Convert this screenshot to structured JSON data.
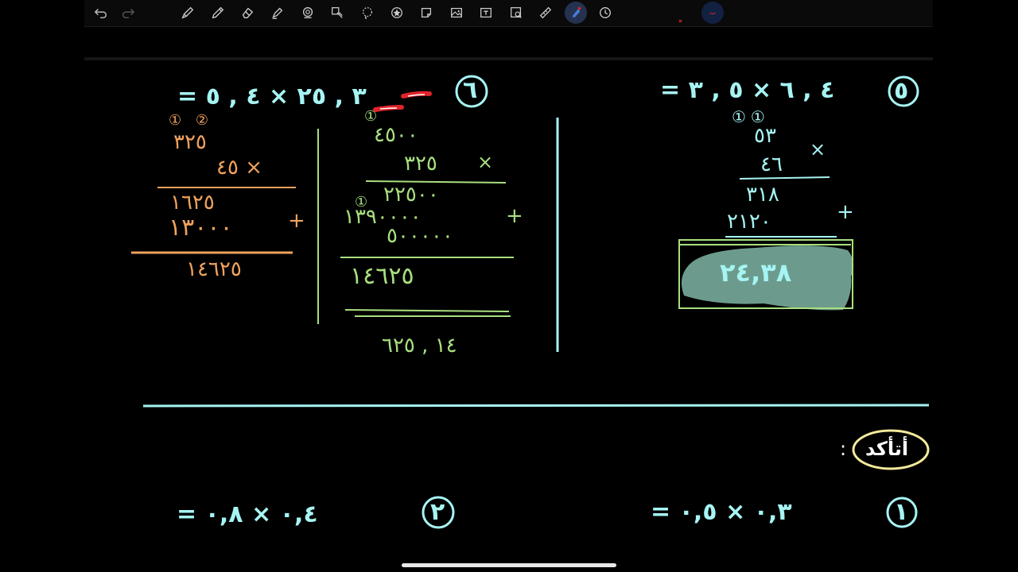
{
  "colors": {
    "cyan_ink": "#a6f4f3",
    "green_ink": "#a9df7f",
    "orange_ink": "#f0a35e",
    "red_ink": "#e0242a",
    "highlight_ink": "#7fb6a6",
    "yellow_ink": "#f3ea9a",
    "active_tool": "#24324f"
  },
  "toolbar": {
    "tools": [
      "undo-icon",
      "redo-icon",
      "pen-icon",
      "pencil-icon",
      "eraser-icon",
      "highlighter-icon",
      "shape-icon",
      "sticker-icon",
      "lasso-icon",
      "star-stamp-icon",
      "sticky-note-icon",
      "image-icon",
      "text-box-icon",
      "image-search-icon",
      "ruler-icon",
      "active-tool-icon",
      "clock-icon"
    ],
    "selected_colors": [
      "red",
      "navy"
    ]
  },
  "problem5": {
    "number": "٥",
    "equation": "= ٤ , ٦ × ٥ , ٣",
    "carries": "①①",
    "top_row": "٥٣",
    "times": "×",
    "second_row": "٤٦",
    "partial1": "٣١٨",
    "plus": "+",
    "partial2": "٢١٢٠",
    "result": "٢٤,٣٨"
  },
  "problem6": {
    "number": "٦",
    "equation": "= ٣ , ٢٥ × ٤ , ٥",
    "green": {
      "carry": "①",
      "top_row": "٤٥٠٠",
      "times": "×",
      "second_row": "٣٢٥",
      "carry2": "①",
      "partial1": "٢٢٥٠٠",
      "partial2": "١٣٩٠٠٠٠",
      "plus": "+",
      "partial3": "٥٠٠٠٠٠",
      "sum": "١٤٦٢٥",
      "answer": "١٤ , ٦٢٥"
    },
    "orange": {
      "carries": "① ②",
      "top_row": "٣٢٥",
      "second_row": "٤٥ ×",
      "partial1": "١٦٢٥",
      "partial2": "١٣٠٠٠",
      "plus": "+",
      "sum": "١٤٦٢٥"
    }
  },
  "check_yourself": {
    "label": "أتأكد",
    "colon": ":"
  },
  "exercise1": {
    "number": "١",
    "equation": "= ٠,٣ × ٠,٥"
  },
  "exercise2": {
    "number": "٢",
    "equation": "= ٠,٤ × ٠,٨"
  }
}
